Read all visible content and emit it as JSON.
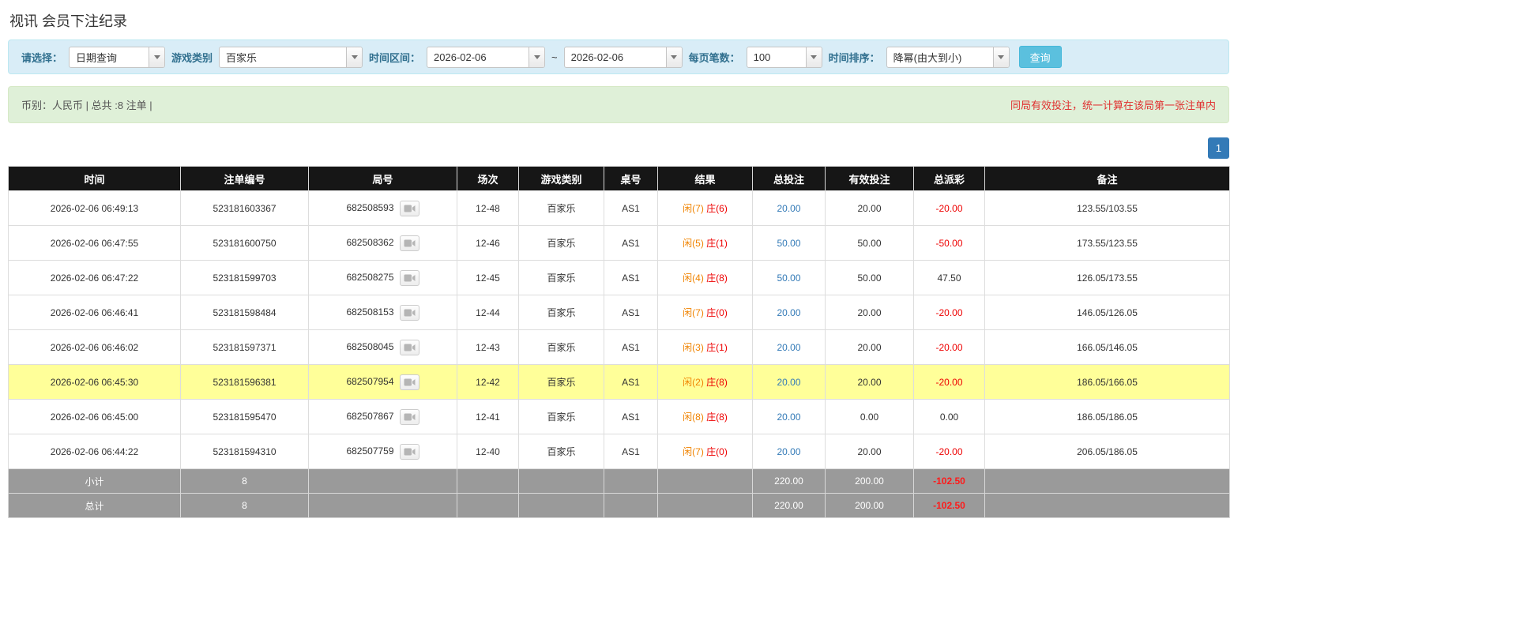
{
  "page_title": "视讯 会员下注纪录",
  "filter": {
    "select_label": "请选择：",
    "select_value": "日期查询",
    "game_type_label": "游戏类别",
    "game_type_value": "百家乐",
    "time_range_label": "时间区间：",
    "date_from": "2026-02-06",
    "range_separator": "~",
    "date_to": "2026-02-06",
    "page_size_label": "每页笔数：",
    "page_size_value": "100",
    "sort_label": "时间排序：",
    "sort_value": "降幂(由大到小)",
    "search_button_label": "查询"
  },
  "summary": {
    "info_text": "币别：人民币 | 总共 :8 注单 |",
    "note_text": "同局有效投注，统一计算在该局第一张注单内"
  },
  "pagination": {
    "current_page": "1"
  },
  "table": {
    "headers": [
      "时间",
      "注单编号",
      "局号",
      "场次",
      "游戏类别",
      "桌号",
      "结果",
      "总投注",
      "有效投注",
      "总派彩",
      "备注"
    ],
    "rows": [
      {
        "time": "2026-02-06 06:49:13",
        "bet_id": "523181603367",
        "round_id": "682508593",
        "session": "12-48",
        "game_type": "百家乐",
        "table_no": "AS1",
        "result_player": "闲(7)",
        "result_banker": "庄(6)",
        "total_bet": "20.00",
        "valid_bet": "20.00",
        "payout": "-20.00",
        "remark": "123.55/103.55",
        "highlighted": false
      },
      {
        "time": "2026-02-06 06:47:55",
        "bet_id": "523181600750",
        "round_id": "682508362",
        "session": "12-46",
        "game_type": "百家乐",
        "table_no": "AS1",
        "result_player": "闲(5)",
        "result_banker": "庄(1)",
        "total_bet": "50.00",
        "valid_bet": "50.00",
        "payout": "-50.00",
        "remark": "173.55/123.55",
        "highlighted": false
      },
      {
        "time": "2026-02-06 06:47:22",
        "bet_id": "523181599703",
        "round_id": "682508275",
        "session": "12-45",
        "game_type": "百家乐",
        "table_no": "AS1",
        "result_player": "闲(4)",
        "result_banker": "庄(8)",
        "total_bet": "50.00",
        "valid_bet": "50.00",
        "payout": "47.50",
        "remark": "126.05/173.55",
        "highlighted": false
      },
      {
        "time": "2026-02-06 06:46:41",
        "bet_id": "523181598484",
        "round_id": "682508153",
        "session": "12-44",
        "game_type": "百家乐",
        "table_no": "AS1",
        "result_player": "闲(7)",
        "result_banker": "庄(0)",
        "total_bet": "20.00",
        "valid_bet": "20.00",
        "payout": "-20.00",
        "remark": "146.05/126.05",
        "highlighted": false
      },
      {
        "time": "2026-02-06 06:46:02",
        "bet_id": "523181597371",
        "round_id": "682508045",
        "session": "12-43",
        "game_type": "百家乐",
        "table_no": "AS1",
        "result_player": "闲(3)",
        "result_banker": "庄(1)",
        "total_bet": "20.00",
        "valid_bet": "20.00",
        "payout": "-20.00",
        "remark": "166.05/146.05",
        "highlighted": false
      },
      {
        "time": "2026-02-06 06:45:30",
        "bet_id": "523181596381",
        "round_id": "682507954",
        "session": "12-42",
        "game_type": "百家乐",
        "table_no": "AS1",
        "result_player": "闲(2)",
        "result_banker": "庄(8)",
        "total_bet": "20.00",
        "valid_bet": "20.00",
        "payout": "-20.00",
        "remark": "186.05/166.05",
        "highlighted": true
      },
      {
        "time": "2026-02-06 06:45:00",
        "bet_id": "523181595470",
        "round_id": "682507867",
        "session": "12-41",
        "game_type": "百家乐",
        "table_no": "AS1",
        "result_player": "闲(8)",
        "result_banker": "庄(8)",
        "total_bet": "20.00",
        "valid_bet": "0.00",
        "payout": "0.00",
        "remark": "186.05/186.05",
        "highlighted": false
      },
      {
        "time": "2026-02-06 06:44:22",
        "bet_id": "523181594310",
        "round_id": "682507759",
        "session": "12-40",
        "game_type": "百家乐",
        "table_no": "AS1",
        "result_player": "闲(7)",
        "result_banker": "庄(0)",
        "total_bet": "20.00",
        "valid_bet": "20.00",
        "payout": "-20.00",
        "remark": "206.05/186.05",
        "highlighted": false
      }
    ],
    "subtotal_row": {
      "label": "小计",
      "count": "8",
      "total_bet": "220.00",
      "valid_bet": "200.00",
      "payout": "-102.50"
    },
    "total_row": {
      "label": "总计",
      "count": "8",
      "total_bet": "220.00",
      "valid_bet": "200.00",
      "payout": "-102.50"
    }
  },
  "colors": {
    "accent_blue": "#337ab7",
    "search_button_blue": "#5bc0de",
    "negative_red": "#ee0000",
    "player_orange": "#f08300",
    "banker_red": "#ee0000",
    "highlight_yellow": "#ffff99",
    "header_black": "#161616",
    "footer_gray": "#9a9a9a",
    "filter_bar_blue": "#d9edf7",
    "summary_bar_green": "#dff0d8"
  }
}
